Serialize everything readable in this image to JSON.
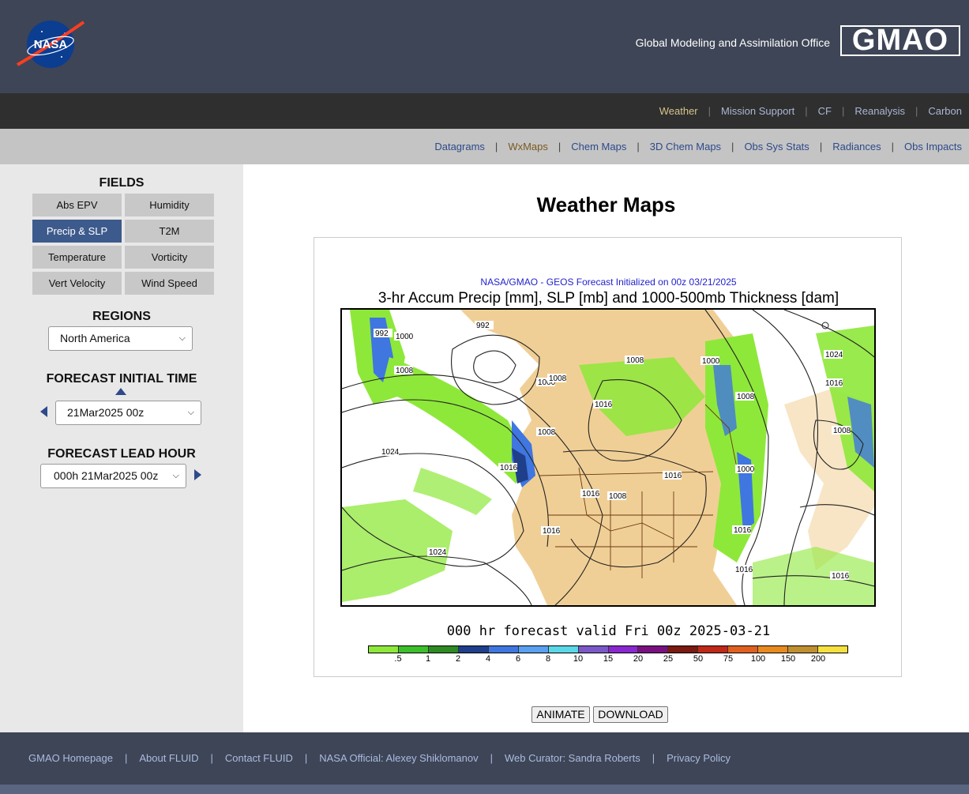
{
  "header": {
    "org_name": "Global Modeling and Assimilation Office",
    "logo_text": "GMAO",
    "nasa_logo_text": "NASA"
  },
  "nav_primary": {
    "items": [
      "Weather",
      "Mission Support",
      "CF",
      "Reanalysis",
      "Carbon"
    ],
    "active": "Weather"
  },
  "nav_secondary": {
    "items": [
      "Datagrams",
      "WxMaps",
      "Chem Maps",
      "3D Chem Maps",
      "Obs Sys Stats",
      "Radiances",
      "Obs Impacts"
    ],
    "active": "WxMaps"
  },
  "sidebar": {
    "fields_title": "FIELDS",
    "fields": [
      "Abs EPV",
      "Humidity",
      "Precip & SLP",
      "T2M",
      "Temperature",
      "Vorticity",
      "Vert Velocity",
      "Wind Speed"
    ],
    "active_field": "Precip & SLP",
    "regions_title": "REGIONS",
    "region_value": "North America",
    "init_title": "FORECAST INITIAL TIME",
    "init_value": "21Mar2025 00z",
    "lead_title": "FORECAST LEAD HOUR",
    "lead_value": "000h 21Mar2025 00z"
  },
  "main": {
    "page_title": "Weather Maps",
    "map_subtitle": "NASA/GMAO - GEOS Forecast Initialized on 00z 03/21/2025",
    "map_title": "3-hr Accum Precip [mm], SLP [mb] and 1000-500mb Thickness [dam]",
    "valid_text": "000 hr forecast valid Fri 00z 2025-03-21",
    "colorbar_labels": [
      ".5",
      "1",
      "2",
      "4",
      "6",
      "8",
      "10",
      "15",
      "20",
      "25",
      "50",
      "75",
      "100",
      "150",
      "200"
    ],
    "colorbar_colors": [
      "#8ee83a",
      "#3cbf2a",
      "#2e8a22",
      "#1f3f8a",
      "#3f76e0",
      "#5aa0f0",
      "#5ad8e8",
      "#7a58c8",
      "#8a28d0",
      "#7a1080",
      "#7a1a10",
      "#c02818",
      "#e06020",
      "#e88a20",
      "#c09030",
      "#f5e040"
    ],
    "isobar_labels": [
      "992",
      "1000",
      "1008",
      "992",
      "1000",
      "1008",
      "1008",
      "1016",
      "1000",
      "1008",
      "1024",
      "1016",
      "1008",
      "1016",
      "1024",
      "1008",
      "1016",
      "1016",
      "1000",
      "1024",
      "1016",
      "1008",
      "1016",
      "1016",
      "1016"
    ],
    "animate_label": "ANIMATE",
    "download_label": "DOWNLOAD"
  },
  "footer": {
    "links": [
      "GMAO Homepage",
      "About FLUID",
      "Contact FLUID",
      "NASA Official: Alexey Shiklomanov",
      "Web Curator: Sandra Roberts",
      "Privacy Policy"
    ]
  }
}
